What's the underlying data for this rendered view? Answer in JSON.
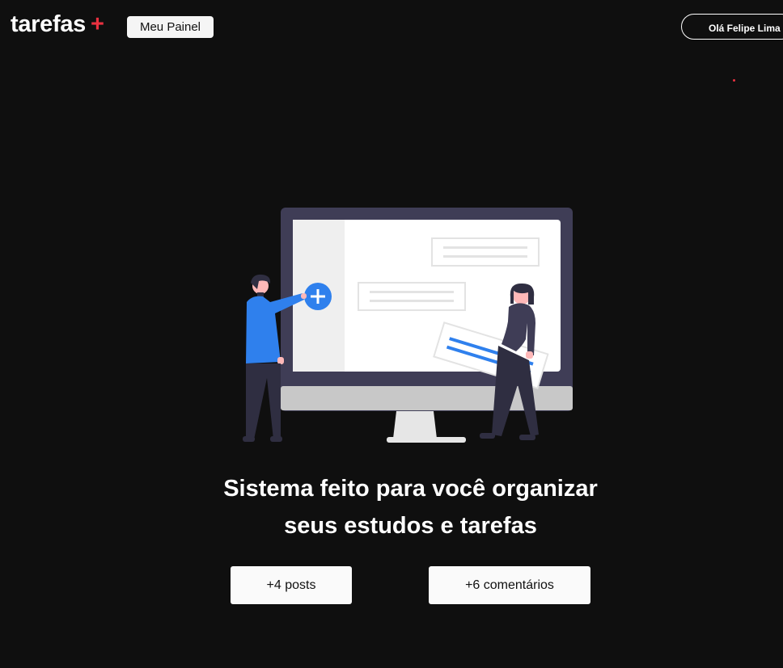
{
  "header": {
    "logo_text": "tarefas",
    "logo_plus": "+",
    "panel_button": "Meu Painel",
    "user_greeting": "Olá Felipe Lima"
  },
  "hero": {
    "illustration_icon": "task-board-illustration",
    "title_line1": "Sistema feito para você organizar",
    "title_line2": "seus estudos e tarefas"
  },
  "stats": {
    "posts": "+4 posts",
    "comments": "+6 comentários"
  },
  "colors": {
    "background": "#0f0f0f",
    "accent_red": "#ea3140",
    "accent_blue": "#2f80ed"
  }
}
